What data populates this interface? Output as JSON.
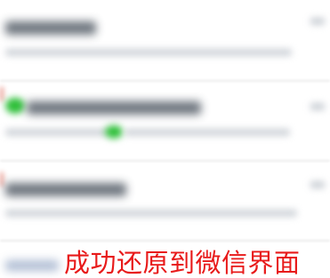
{
  "overlay": {
    "caption": "成功还原到微信界面"
  },
  "colors": {
    "caption": "#e81a1a",
    "accent_green": "#2fbf3a",
    "divider": "#ececec"
  }
}
